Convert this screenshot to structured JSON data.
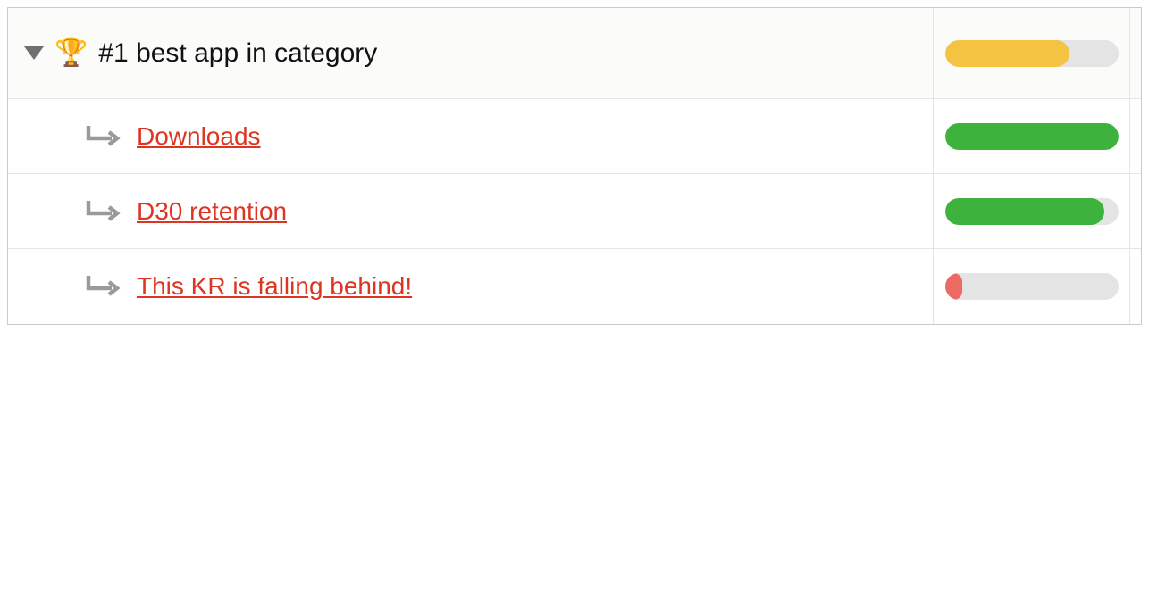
{
  "objective": {
    "icon": "🏆",
    "title": "#1 best app in category",
    "progress": {
      "percent": 72,
      "color": "yellow"
    }
  },
  "key_results": [
    {
      "label": "Downloads",
      "progress": {
        "percent": 100,
        "color": "green"
      }
    },
    {
      "label": "D30 retention",
      "progress": {
        "percent": 92,
        "color": "green"
      }
    },
    {
      "label": "This KR is falling behind!",
      "progress": {
        "percent": 10,
        "color": "red"
      }
    }
  ]
}
